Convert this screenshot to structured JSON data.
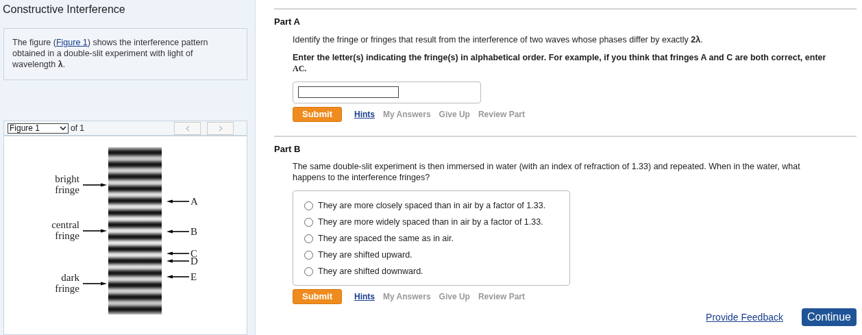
{
  "title": "Constructive Interference",
  "intro": {
    "before": "The figure (",
    "link": "Figure 1",
    "after": ") shows the interference pattern obtained in a double-slit experiment with light of wavelength **λ**."
  },
  "figure_viewer": {
    "select": "Figure 1",
    "of": "of 1",
    "prev_disabled": true,
    "next_disabled": true,
    "figure": {
      "left_labels": [
        {
          "lines": [
            "bright",
            "fringe"
          ]
        },
        {
          "lines": [
            "central",
            "fringe"
          ]
        },
        {
          "lines": [
            "dark",
            "fringe"
          ]
        }
      ],
      "right_labels": [
        "A",
        "B",
        "C",
        "D",
        "E"
      ]
    }
  },
  "parts": [
    {
      "title": "Part A",
      "kind": "text",
      "prompt": "Identify the fringe or fringes that result from the interference of two waves whose phases differ by exactly **2λ**.",
      "instruction": "Enter the letter(s) indicating the fringe(s) in alphabetical order. For example, if you think that fringes A and C are both correct, enter",
      "example": "AC.",
      "submit": "Submit",
      "links": [
        {
          "label": "Hints",
          "disabled": false
        },
        {
          "label": "My Answers",
          "disabled": true
        },
        {
          "label": "Give Up",
          "disabled": true
        },
        {
          "label": "Review Part",
          "disabled": true
        }
      ]
    },
    {
      "title": "Part B",
      "kind": "choice",
      "prompt": "The same double-slit experiment is then immersed in water (with an index of refraction of 1.33) and repeated. When in the water, what happens to the interference fringes?",
      "options": [
        {
          "label": "They are more closely spaced than in air by a factor of 1.33.",
          "selected": false
        },
        {
          "label": "They are more widely spaced than in air by a factor of 1.33.",
          "selected": false
        },
        {
          "label": "They are spaced the same as in air.",
          "selected": false
        },
        {
          "label": "They are shifted upward.",
          "selected": false
        },
        {
          "label": "They are shifted downward.",
          "selected": false
        }
      ],
      "submit": "Submit",
      "links": [
        {
          "label": "Hints",
          "disabled": false
        },
        {
          "label": "My Answers",
          "disabled": true
        },
        {
          "label": "Give Up",
          "disabled": true
        },
        {
          "label": "Review Part",
          "disabled": true
        }
      ]
    }
  ],
  "footer": {
    "feedback": "Provide Feedback",
    "continue": "Continue"
  }
}
